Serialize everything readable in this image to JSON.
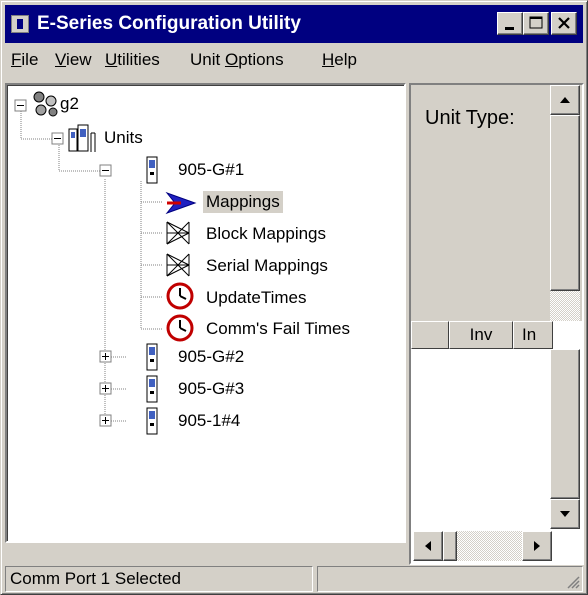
{
  "window": {
    "title": "E-Series Configuration Utility",
    "controls": [
      "minimize",
      "maximize",
      "close"
    ]
  },
  "menu": {
    "items": [
      {
        "label": "File",
        "mnemonic": "F"
      },
      {
        "label": "View",
        "mnemonic": "V"
      },
      {
        "label": "Utilities",
        "mnemonic": "U"
      },
      {
        "label": "Unit Options",
        "mnemonic": "O"
      },
      {
        "label": "Help",
        "mnemonic": "H"
      }
    ]
  },
  "tree": {
    "root": {
      "label": "g2",
      "icon": "network-icon",
      "expanded": true
    },
    "units": {
      "label": "Units",
      "icon": "units-icon",
      "expanded": true
    },
    "unit1": {
      "label": "905-G#1",
      "icon": "radio-unit-icon",
      "expanded": true
    },
    "children": [
      {
        "label": "Mappings",
        "icon": "arrow-icon",
        "selected": true
      },
      {
        "label": "Block Mappings",
        "icon": "mapping-icon"
      },
      {
        "label": "Serial Mappings",
        "icon": "mapping-icon"
      },
      {
        "label": "UpdateTimes",
        "icon": "clock-icon"
      },
      {
        "label": "Comm's Fail Times",
        "icon": "clock-icon"
      }
    ],
    "other_units": [
      {
        "label": "905-G#2",
        "icon": "radio-unit-icon",
        "expanded": false
      },
      {
        "label": "905-G#3",
        "icon": "radio-unit-icon",
        "expanded": false
      },
      {
        "label": "905-1#4",
        "icon": "radio-unit-icon",
        "expanded": false
      }
    ]
  },
  "details": {
    "unit_type_label": "Unit Type:",
    "columns": [
      "",
      "Inv",
      "In"
    ]
  },
  "status": {
    "message": "Comm Port 1 Selected",
    "secondary": ""
  },
  "colors": {
    "titlebar": "#000080",
    "face": "#d4d0c8",
    "selection": "#d4d0c8"
  }
}
